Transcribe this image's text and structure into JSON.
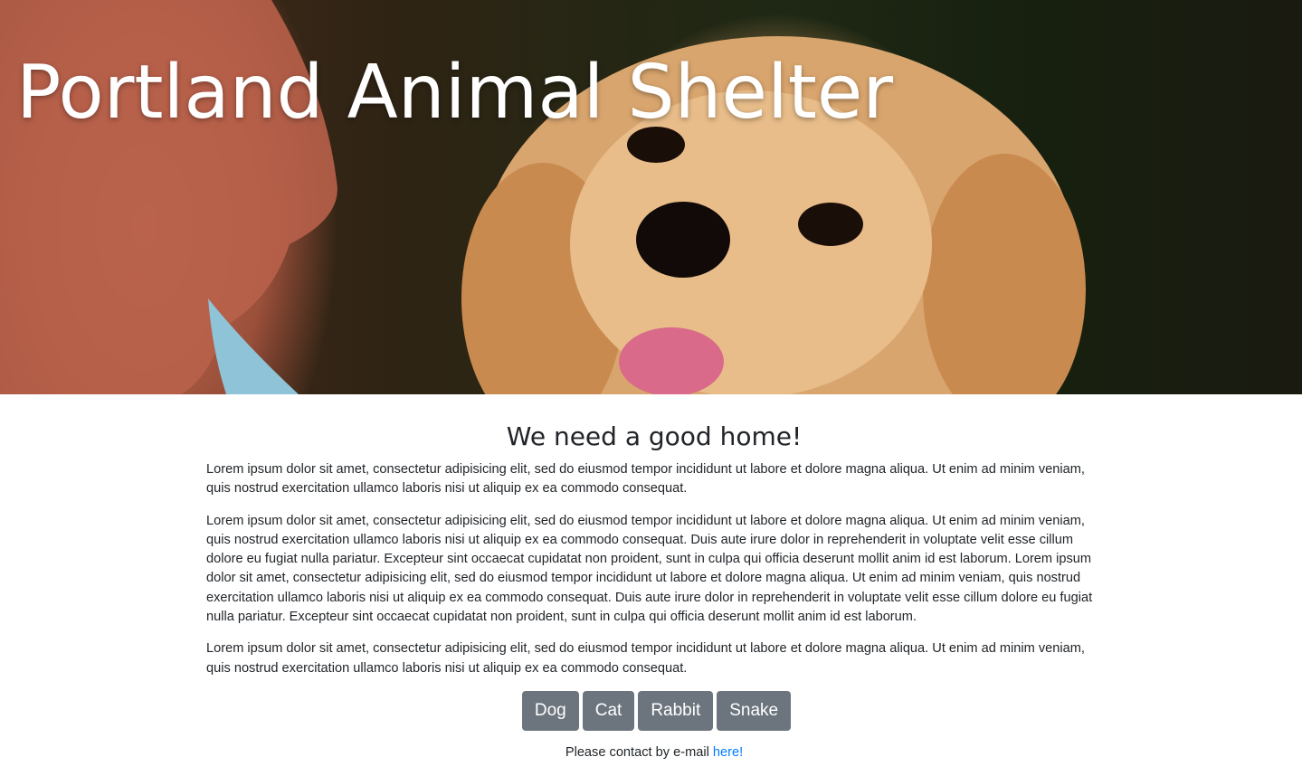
{
  "hero": {
    "title": "Portland Animal Shelter"
  },
  "main": {
    "heading": "We need a good home!",
    "paragraphs": [
      "Lorem ipsum dolor sit amet, consectetur adipisicing elit, sed do eiusmod tempor incididunt ut labore et dolore magna aliqua. Ut enim ad minim veniam, quis nostrud exercitation ullamco laboris nisi ut aliquip ex ea commodo consequat.",
      "Lorem ipsum dolor sit amet, consectetur adipisicing elit, sed do eiusmod tempor incididunt ut labore et dolore magna aliqua. Ut enim ad minim veniam, quis nostrud exercitation ullamco laboris nisi ut aliquip ex ea commodo consequat. Duis aute irure dolor in reprehenderit in voluptate velit esse cillum dolore eu fugiat nulla pariatur. Excepteur sint occaecat cupidatat non proident, sunt in culpa qui officia deserunt mollit anim id est laborum. Lorem ipsum dolor sit amet, consectetur adipisicing elit, sed do eiusmod tempor incididunt ut labore et dolore magna aliqua. Ut enim ad minim veniam, quis nostrud exercitation ullamco laboris nisi ut aliquip ex ea commodo consequat. Duis aute irure dolor in reprehenderit in voluptate velit esse cillum dolore eu fugiat nulla pariatur. Excepteur sint occaecat cupidatat non proident, sunt in culpa qui officia deserunt mollit anim id est laborum.",
      "Lorem ipsum dolor sit amet, consectetur adipisicing elit, sed do eiusmod tempor incididunt ut labore et dolore magna aliqua. Ut enim ad minim veniam, quis nostrud exercitation ullamco laboris nisi ut aliquip ex ea commodo consequat."
    ],
    "buttons": [
      "Dog",
      "Cat",
      "Rabbit",
      "Snake"
    ]
  },
  "contact": {
    "text": "Please contact by e-mail ",
    "link_label": "here!"
  },
  "colors": {
    "button_bg": "#6c757d",
    "link": "#007bff",
    "text": "#212529"
  }
}
